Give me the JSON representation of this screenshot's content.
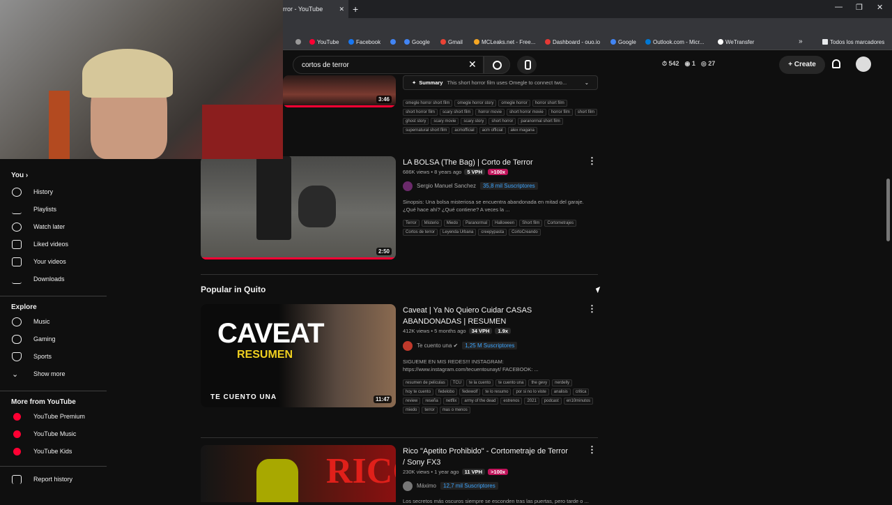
{
  "browser": {
    "tab_title": "rror - YouTube",
    "tab_close": "✕",
    "new_tab": "+",
    "window_min": "—",
    "window_restore": "❐",
    "window_close": "✕",
    "bookmarks": [
      {
        "label": "YouTube",
        "color": "#ff0033"
      },
      {
        "label": "Facebook",
        "color": "#1877f2"
      },
      {
        "label": "Google",
        "color": "#4285f4"
      },
      {
        "label": "Gmail",
        "color": "#ea4335"
      },
      {
        "label": "MCLeaks.net - Free...",
        "color": "#f5a623"
      },
      {
        "label": "Dashboard - ouo.io",
        "color": "#e53935"
      },
      {
        "label": "Google",
        "color": "#4285f4"
      },
      {
        "label": "Outlook.com - Micr...",
        "color": "#0078d4"
      },
      {
        "label": "WeTransfer",
        "color": "#ffffff"
      }
    ],
    "bookmarks_more": "»",
    "all_bookmarks": "Todos los marcadores"
  },
  "header": {
    "search_value": "cortos de terror",
    "clear_glyph": "✕",
    "stats": [
      "⏱ 542",
      "◉ 1",
      "◎ 27"
    ],
    "create_label": "+  Create"
  },
  "sidebar": {
    "you_label": "You  ›",
    "you_items": [
      "History",
      "Playlists",
      "Watch later",
      "Liked videos",
      "Your videos",
      "Downloads"
    ],
    "explore_label": "Explore",
    "explore_items": [
      "Music",
      "Gaming",
      "Sports",
      "Show more"
    ],
    "more_label": "More from YouTube",
    "more_items": [
      "YouTube Premium",
      "YouTube Music",
      "YouTube Kids"
    ],
    "report": "Report history"
  },
  "video1": {
    "duration": "3:46",
    "summary_label": "Summary",
    "summary_text": "This short horror film uses Omegle to connect two...",
    "summary_icon": "✦",
    "chevron": "⌄",
    "tags": [
      "omegle horror short film",
      "omegle horror story",
      "omegle horror",
      "horror short film",
      "short horror film",
      "scary short film",
      "horror movie",
      "short horror movie",
      "horror film",
      "short film",
      "ghost story",
      "scary movie",
      "scary story",
      "short horror",
      "paranormal short film",
      "supernatural short film",
      "acmofficial",
      "acm official",
      "alex magana"
    ]
  },
  "video2": {
    "title": "LA BOLSA (The Bag) | Corto de Terror",
    "meta": "686K views • 8 years ago",
    "vph": "5 VPH",
    "ratio": ">100x",
    "channel": "Sergio Manuel Sanchez",
    "subs": "35,8 mil Suscriptores",
    "desc": "Sinopsis: Una bolsa misteriosa se encuentra abandonada en mitad del garaje. ¿Qué hace ahí? ¿Qué contiene? A veces la ...",
    "tags": [
      "Terror",
      "Misterio",
      "Miedo",
      "Paranormal",
      "Halloween",
      "Short film",
      "Cortometrajes",
      "Cortos de terror",
      "Leyenda Urbana",
      "creepypasta",
      "CortoCreando"
    ],
    "duration": "2:50"
  },
  "section_title": "Popular in Quito",
  "video3": {
    "title": "Caveat | Ya No Quiero Cuidar CASAS ABANDONADAS | RESUMEN",
    "meta": "412K views • 5 months ago",
    "vph": "34 VPH",
    "ratio": "1.9x",
    "channel": "Te cuento una ✔",
    "subs": "1,25 M Suscriptores",
    "desc": "SIGUEME EN MIS REDES!!! INSTAGRAM: https://www.instagram.com/tecuentounayt/ FACEBOOK: ...",
    "tags": [
      "resumen de peliculas",
      "TCU",
      "te la cuento",
      "te cuento una",
      "the gevy",
      "nerdelly",
      "hoy te cuento",
      "fedelobo",
      "fedewolf",
      "te lo resumo",
      "por si no lo viste",
      "analisis",
      "critica",
      "review",
      "reseña",
      "netflix",
      "army of the dead",
      "estrenos",
      "2021",
      "podcast",
      "en10minutos",
      "miedo",
      "terror",
      "mas o menos"
    ],
    "thumb_word": "CAVEAT",
    "thumb_sub": "RESUMEN",
    "thumb_brand": "TE CUENTO UNA",
    "duration": "11:47"
  },
  "video4": {
    "title": "Rico \"Apetito Prohibido\" - Cortometraje de Terror / Sony FX3",
    "meta": "230K views • 1 year ago",
    "vph": "11 VPH",
    "ratio": ">100x",
    "channel": "Máximo",
    "subs": "12,7 mil Suscriptores",
    "desc": "Los secretos más oscuros siempre se esconden tras las puertas, pero tarde o ...",
    "thumb_word": "RICO"
  },
  "kebab": "⋮"
}
